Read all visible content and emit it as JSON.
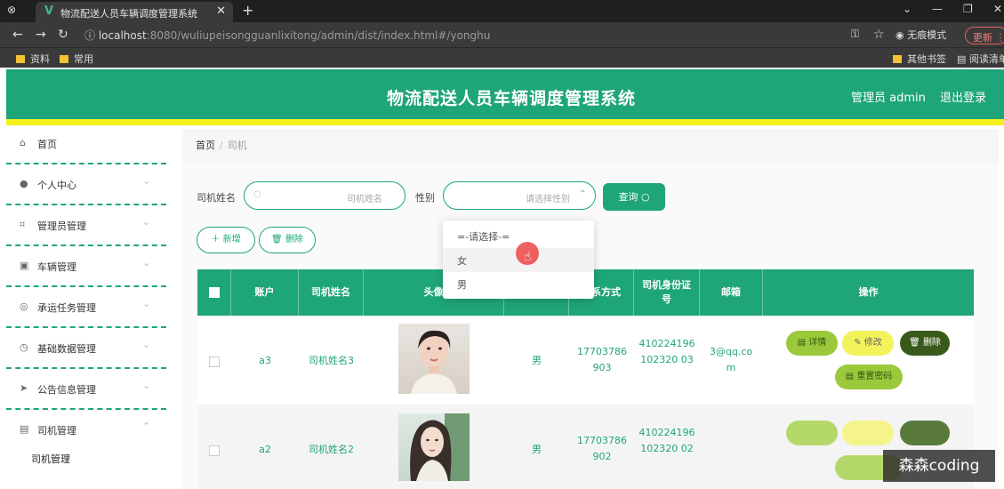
{
  "browser": {
    "tab_title": "物流配送人员车辆调度管理系统",
    "url_host": "localhost",
    "url_rest": ":8080/wuliupeisongguanlixitong/admin/dist/index.html#/yonghu",
    "incognito": "无痕模式",
    "update": "更新",
    "bookmarks": [
      "资料",
      "常用"
    ],
    "other_bookmarks": "其他书签",
    "reading_list": "阅读清单"
  },
  "header": {
    "title": "物流配送人员车辆调度管理系统",
    "admin": "管理员 admin",
    "logout": "退出登录"
  },
  "sidebar": {
    "items": [
      {
        "label": "首页"
      },
      {
        "label": "个人中心"
      },
      {
        "label": "管理员管理"
      },
      {
        "label": "车辆管理"
      },
      {
        "label": "承运任务管理"
      },
      {
        "label": "基础数据管理"
      },
      {
        "label": "公告信息管理"
      },
      {
        "label": "司机管理"
      }
    ],
    "sub_item": "司机管理"
  },
  "breadcrumb": {
    "home": "首页",
    "sep": "/",
    "current": "司机"
  },
  "search": {
    "name_label": "司机姓名",
    "name_placeholder": "司机姓名",
    "gender_label": "性别",
    "gender_placeholder": "请选择性别",
    "query": "查询"
  },
  "actions": {
    "add": "新增",
    "delete": "删除"
  },
  "dropdown": {
    "options": [
      "=-请选择-=",
      "女",
      "男"
    ]
  },
  "table": {
    "headers": [
      "账户",
      "司机姓名",
      "头像",
      "性别",
      "联系方式",
      "司机身份证号",
      "邮箱",
      "操作"
    ],
    "rows": [
      {
        "account": "a3",
        "name": "司机姓名3",
        "gender": "男",
        "phone": "17703786903",
        "idcard": "410224196102320 03",
        "email": "3@qq.com"
      },
      {
        "account": "a2",
        "name": "司机姓名2",
        "gender": "男",
        "phone": "17703786902",
        "idcard": "410224196102320 02",
        "email": ""
      }
    ],
    "row_actions": {
      "detail": "详情",
      "edit": "修改",
      "delete": "删除",
      "reset": "重置密码"
    }
  },
  "watermark": "森森coding",
  "colors": {
    "primary": "#1fa57a",
    "accent": "#f3f31e"
  }
}
